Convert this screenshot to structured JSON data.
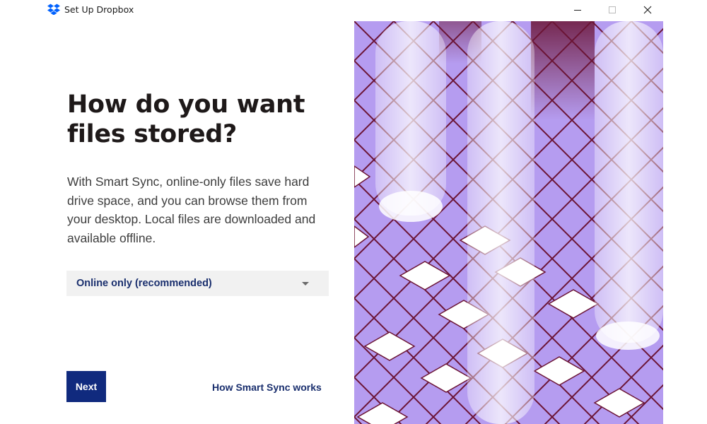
{
  "window": {
    "title": "Set Up Dropbox",
    "controls": {
      "minimize_icon": "minimize-icon",
      "maximize_icon": "maximize-icon",
      "close_icon": "close-icon"
    }
  },
  "main": {
    "heading_line1": "How do you want",
    "heading_line2": "files stored?",
    "description": "With Smart Sync, online-only files save hard drive space, and you can browse them from your desktop. Local files are downloaded and available offline.",
    "storage_select": {
      "selected": "Online only (recommended)"
    },
    "next_label": "Next",
    "help_link": "How Smart Sync works"
  },
  "colors": {
    "brand_blue": "#0061fe",
    "button_navy": "#102a7e",
    "link_navy": "#1a2f6e",
    "art_lavender": "#b59cf0",
    "art_maroon": "#6b1435"
  }
}
